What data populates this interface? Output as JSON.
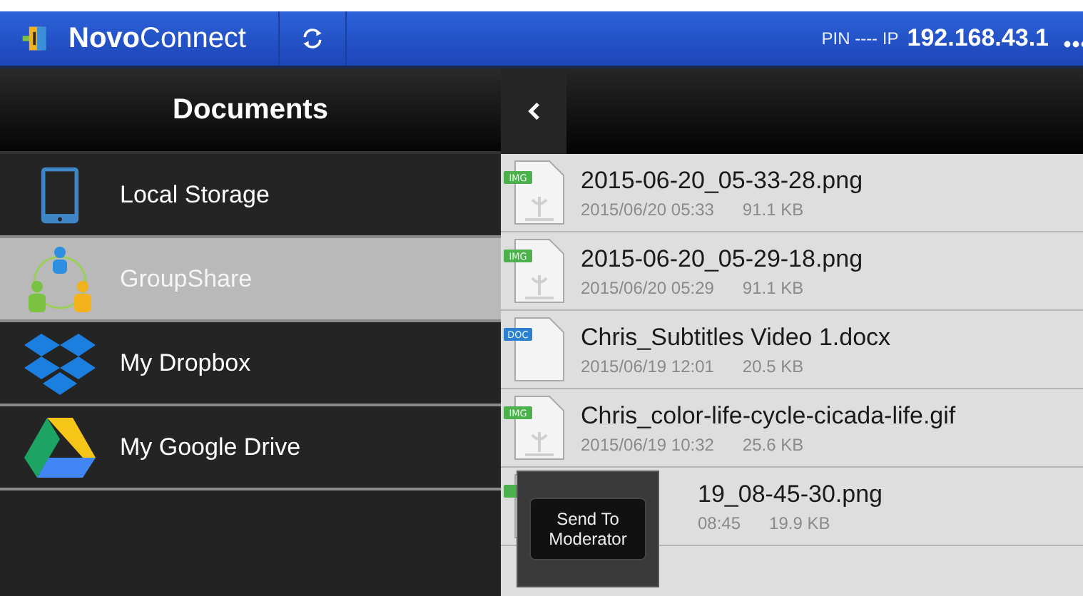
{
  "app_bar": {
    "title": "**Novo**Connect",
    "pin_label": "PIN ---- IP",
    "ip": "192.168.43.1"
  },
  "sidebar": {
    "title": "Documents",
    "items": [
      {
        "label": "Local Storage",
        "kind": "tablet",
        "selected": false
      },
      {
        "label": "GroupShare",
        "kind": "group",
        "selected": true
      },
      {
        "label": "My Dropbox",
        "kind": "dropbox",
        "selected": false
      },
      {
        "label": "My Google Drive",
        "kind": "drive",
        "selected": false
      }
    ]
  },
  "files": [
    {
      "name": "2015-06-20_05-33-28.png",
      "date": "2015/06/20 05:33",
      "size": "91.1 KB",
      "kind": "img",
      "badge": "IMG",
      "covered": false
    },
    {
      "name": "2015-06-20_05-29-18.png",
      "date": "2015/06/20 05:29",
      "size": "91.1 KB",
      "kind": "img",
      "badge": "IMG",
      "covered": false
    },
    {
      "name": "Chris_Subtitles Video 1.docx",
      "date": "2015/06/19 12:01",
      "size": "20.5 KB",
      "kind": "doc",
      "badge": "DOC",
      "covered": false
    },
    {
      "name": "Chris_color-life-cycle-cicada-life.gif",
      "date": "2015/06/19 10:32",
      "size": "25.6 KB",
      "kind": "img",
      "badge": "IMG",
      "covered": false
    },
    {
      "name": "19_08-45-30.png",
      "date": "08:45",
      "size": "19.9 KB",
      "kind": "img",
      "covered": true
    }
  ],
  "popup": {
    "label": "Send To Moderator"
  }
}
